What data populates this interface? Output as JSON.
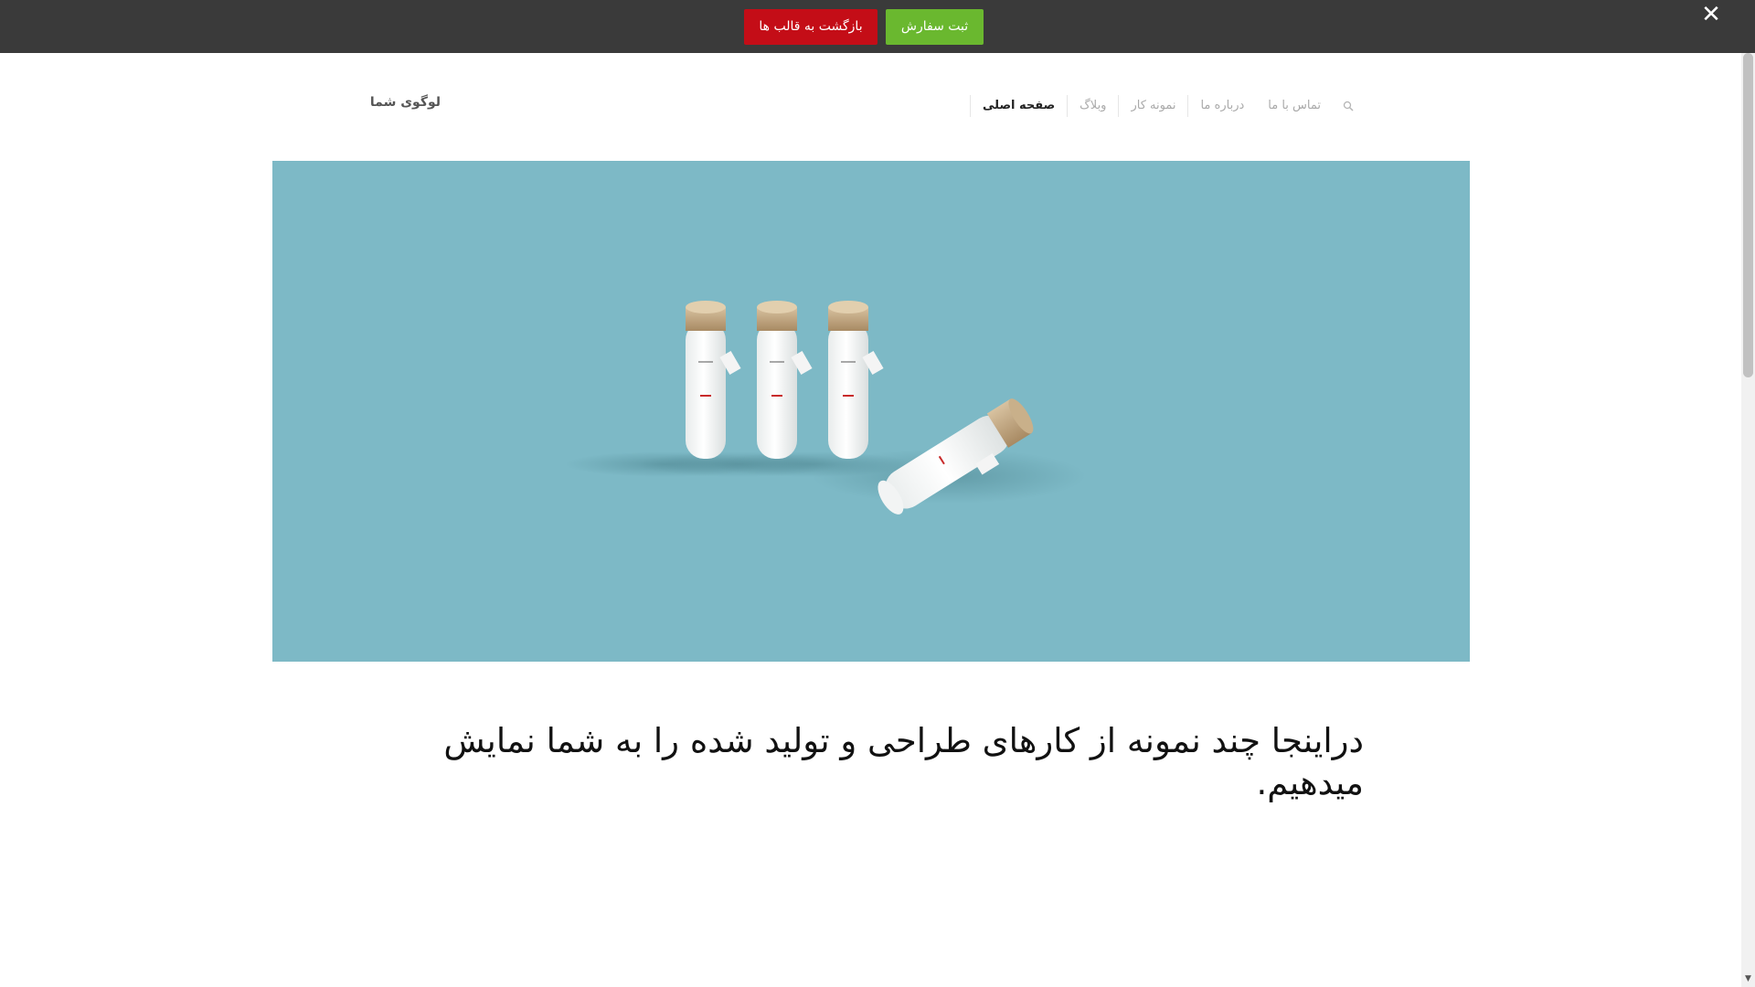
{
  "topbar": {
    "back_label": "بازگشت به قالب ها",
    "order_label": "ثبت سفارش",
    "close_icon": "close-icon",
    "colors": {
      "bar": "#3a3a3a",
      "back": "#c40d17",
      "order": "#6ab82f"
    }
  },
  "header": {
    "logo_text": "لوگوی شما",
    "nav": {
      "home": "صفحه اصلی",
      "blog": "وبلاگ",
      "portfolio": "نمونه کار",
      "about": "درباره ما",
      "contact": "تماس با ما"
    },
    "search_icon": "search-icon"
  },
  "hero": {
    "background": "#7db9c6",
    "image_subject": "product-bottles"
  },
  "content": {
    "headline": "دراینجا چند نمونه از کارهای طراحی و تولید شده را به شما نمایش میدهیم."
  }
}
